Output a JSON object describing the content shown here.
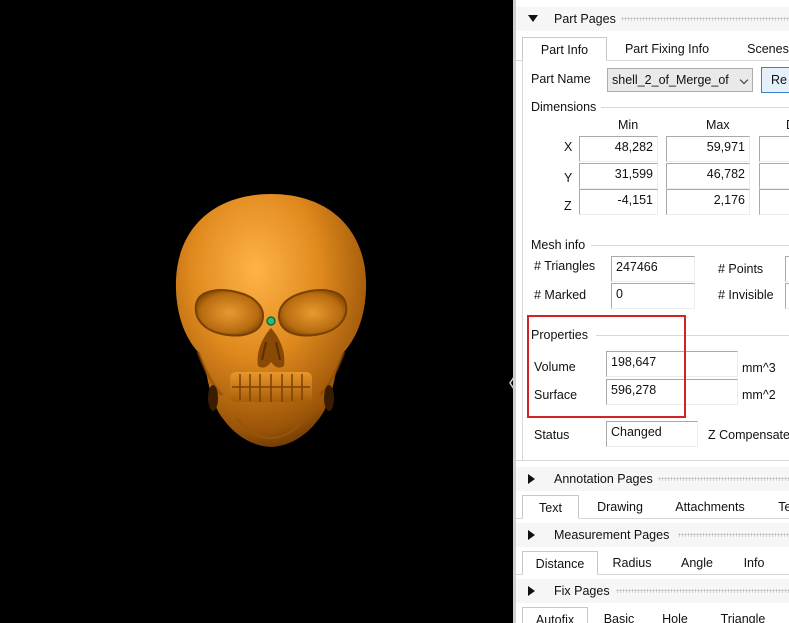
{
  "colors": {
    "accent": "#d22222",
    "viewport_bg": "#000000",
    "model": "#d98a20"
  },
  "viewport": {
    "model": "skull-model"
  },
  "part_pages": {
    "header": "Part Pages",
    "tabs": [
      "Part Info",
      "Part Fixing Info",
      "Scenes"
    ],
    "part_name_label": "Part Name",
    "part_name_value": "shell_2_of_Merge_of",
    "action_button": "Re"
  },
  "dimensions": {
    "title": "Dimensions",
    "col_min": "Min",
    "col_max": "Max",
    "col_third": "D",
    "rows": [
      {
        "axis": "X",
        "min": "48,282",
        "max": "59,971"
      },
      {
        "axis": "Y",
        "min": "31,599",
        "max": "46,782"
      },
      {
        "axis": "Z",
        "min": "-4,151",
        "max": "2,176"
      }
    ]
  },
  "mesh_info": {
    "title": "Mesh info",
    "triangles_label": "# Triangles",
    "triangles_value": "247466",
    "marked_label": "# Marked",
    "marked_value": "0",
    "points_label": "# Points",
    "invisible_label": "# Invisible"
  },
  "properties": {
    "title": "Properties",
    "volume_label": "Volume",
    "volume_value": "198,647",
    "volume_unit": "mm^3",
    "surface_label": "Surface",
    "surface_value": "596,278",
    "surface_unit": "mm^2"
  },
  "status": {
    "label": "Status",
    "value": "Changed",
    "z_comp_label": "Z Compensate"
  },
  "annotation_pages": {
    "header": "Annotation Pages",
    "tabs": [
      "Text",
      "Drawing",
      "Attachments",
      "Tex"
    ]
  },
  "measurement_pages": {
    "header": "Measurement Pages",
    "tabs": [
      "Distance",
      "Radius",
      "Angle",
      "Info"
    ]
  },
  "fix_pages": {
    "header": "Fix Pages",
    "tabs": [
      "Autofix",
      "Basic",
      "Hole",
      "Triangle"
    ]
  }
}
